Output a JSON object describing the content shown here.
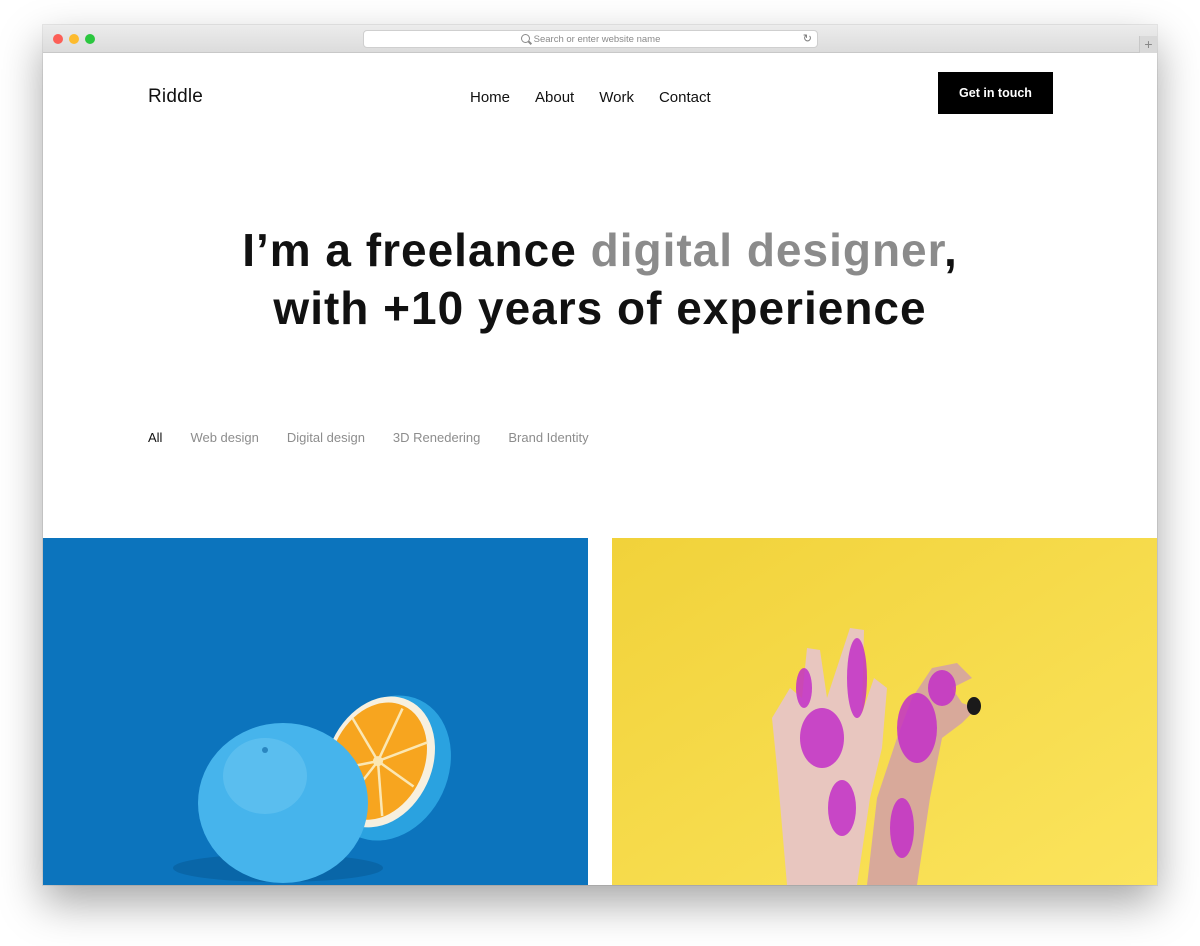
{
  "browser": {
    "url_placeholder": "Search or enter website name",
    "new_tab_label": "+"
  },
  "site": {
    "logo": "Riddle",
    "nav": [
      "Home",
      "About",
      "Work",
      "Contact"
    ],
    "cta_label": "Get in touch"
  },
  "hero": {
    "line1_start": "I’m a freelance ",
    "line1_highlight": "digital designer",
    "line1_end": ",",
    "line2": "with +10 years of experience"
  },
  "filters": [
    "All",
    "Web design",
    "Digital design",
    "3D Renedering",
    "Brand Identity"
  ],
  "colors": {
    "accent_muted": "#8b8b8b",
    "tile_blue": "#0c74bd",
    "tile_yellow": "#f6dc4a",
    "cta_bg": "#000000"
  },
  "portfolio": [
    {
      "image": "blue-orange-photo"
    },
    {
      "image": "purple-glitter-hands-photo"
    }
  ]
}
